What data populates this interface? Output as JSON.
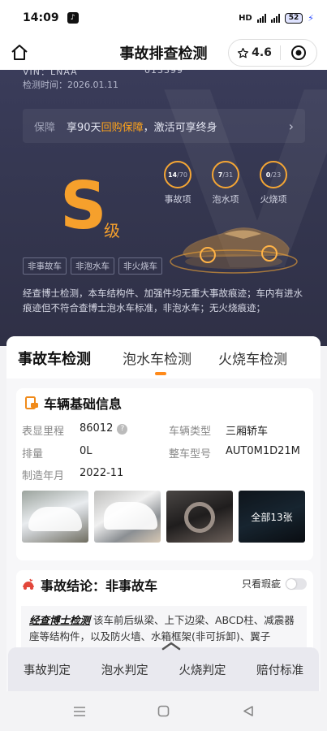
{
  "status_bar": {
    "time": "14:09",
    "network": "HD",
    "battery": "52"
  },
  "header": {
    "title": "事故排查检测",
    "rating": "4.6"
  },
  "hero": {
    "vin_label": "VIN：LNAA",
    "vin_tail": "013399",
    "date": "检测时间：2026.01.11",
    "warranty_label": "保障",
    "warranty_pre": "享90天",
    "warranty_highlight": "回购保障",
    "warranty_post": "，激活可享终身",
    "grade": "S",
    "grade_suffix": "级",
    "rings": [
      {
        "value": "14",
        "total": "/70",
        "name": "事故项"
      },
      {
        "value": "7",
        "total": "/31",
        "name": "泡水项"
      },
      {
        "value": "0",
        "total": "/23",
        "name": "火烧项"
      }
    ],
    "tags": [
      "非事故车",
      "非泡水车",
      "非火烧车"
    ],
    "summary": "经查博士检测，本车结构件、加强件均无重大事故痕迹；车内有进水痕迹但不符合查博士泡水车标准，非泡水车；无火烧痕迹；"
  },
  "tabs": {
    "items": [
      "事故车检测",
      "泡水车检测",
      "火烧车检测"
    ],
    "active": "事故车检测"
  },
  "vehicle_info": {
    "title": "车辆基础信息",
    "mileage_label": "表显里程",
    "mileage_value": "86012",
    "type_label": "车辆类型",
    "type_value": "三厢轿车",
    "displacement_label": "排量",
    "displacement_value": "0L",
    "model_label": "整车型号",
    "model_value": "AUT0M1D21M",
    "date_label": "制造年月",
    "date_value": "2022-11",
    "photos_more": "全部13张"
  },
  "conclusion": {
    "title": "事故结论：非事故车",
    "toggle_label": "只看瑕疵",
    "brand": "经查博士检测",
    "text": "该车前后纵梁、上下边梁、ABCD柱、减震器座等结构件，以及防火墙、水箱框架(非可拆卸)、翼子"
  },
  "bottom_nav": [
    "事故判定",
    "泡水判定",
    "火烧判定",
    "赔付标准"
  ],
  "colors": {
    "accent": "#f6a02c",
    "orange_tab": "#ff8a1a",
    "hero_bg": "#34364f"
  }
}
